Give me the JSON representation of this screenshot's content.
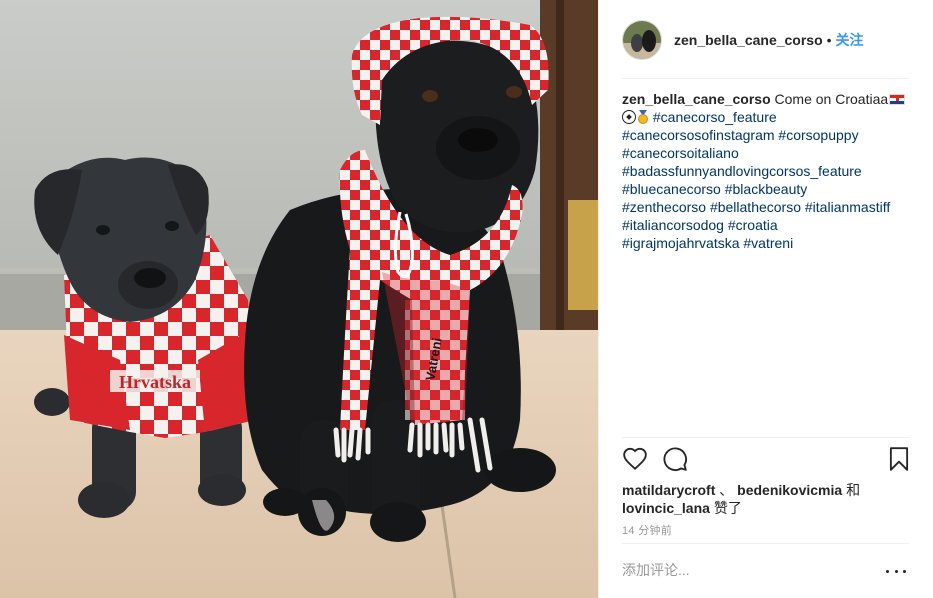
{
  "post": {
    "author": "zen_bella_cane_corso",
    "separator": "•",
    "follow_label": "关注",
    "caption": {
      "username": "zen_bella_cane_corso",
      "text": " Come on Croatiaa",
      "hashtags_line1": "#canecorso_feature",
      "lines": [
        "#canecorsosofinstagram #corsopuppy",
        "#canecorsoitaliano",
        "#badassfunnyandlovingcorsos_feature",
        "#bluecanecorso #blackbeauty",
        "#zenthecorso #bellathecorso #italianmastiff",
        "#italiancorsodog #croatia",
        "#igrajmojahrvatska #vatreni"
      ]
    },
    "likes": {
      "user1": "matildarycroft",
      "sep": "、",
      "user2": "bedenikovicmia",
      "and": "和",
      "user3": "lovincic_lana",
      "suffix": "赞了"
    },
    "timestamp": "14 分钟前",
    "comment_placeholder": "添加评论...",
    "icons": {
      "like": "heart-icon",
      "comment": "comment-icon",
      "save": "bookmark-icon",
      "more": "more-icon"
    }
  },
  "photo": {
    "jersey_text": "Hrvatska",
    "scarf_text": "Vatreni"
  },
  "colors": {
    "link_blue": "#3897f0",
    "hashtag": "#003569",
    "muted": "#999999",
    "text": "#262626",
    "divider": "#efefef"
  }
}
